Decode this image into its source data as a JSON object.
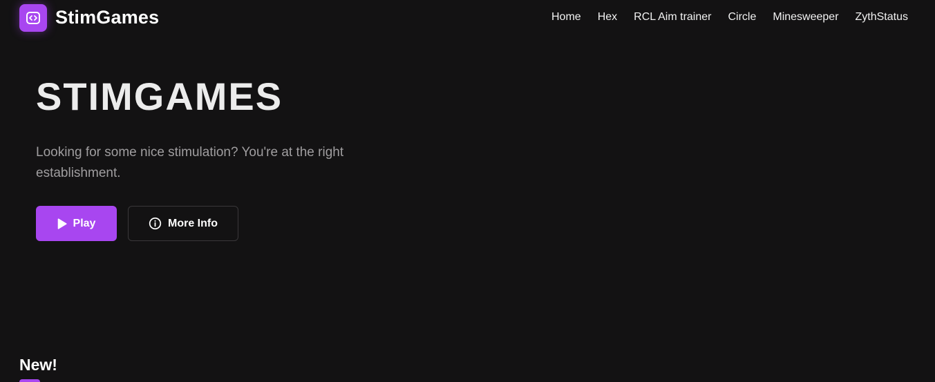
{
  "header": {
    "brand": "StimGames",
    "logo_icon": "code-brackets-icon",
    "nav": [
      {
        "label": "Home"
      },
      {
        "label": "Hex"
      },
      {
        "label": "RCL Aim trainer"
      },
      {
        "label": "Circle"
      },
      {
        "label": "Minesweeper"
      },
      {
        "label": "ZythStatus"
      }
    ]
  },
  "hero": {
    "title": "STIMGAMES",
    "subtitle": "Looking for some nice stimulation? You're at the right establishment.",
    "play_button": {
      "label": "Play",
      "icon": "play-icon"
    },
    "info_button": {
      "label": "More Info",
      "icon": "info-circle-icon"
    }
  },
  "sections": {
    "new_heading": "New!"
  },
  "colors": {
    "background": "#131213",
    "accent": "#a846f0",
    "text": "#ffffff",
    "muted_text": "#a09ea0"
  }
}
